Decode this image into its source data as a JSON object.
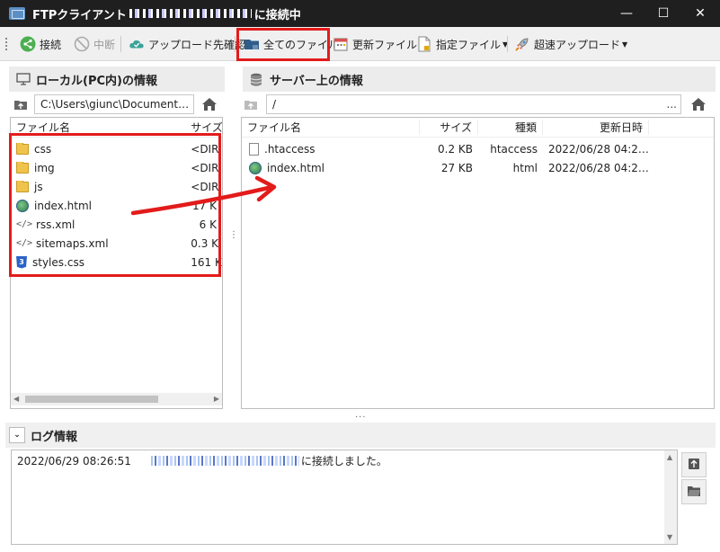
{
  "window": {
    "title_prefix": "FTPクライアント",
    "title_suffix": "に接続中",
    "minimize": "—",
    "maximize": "☐",
    "close": "✕"
  },
  "toolbar": {
    "connect": "接続",
    "abort": "中断",
    "upload_dest": "アップロード先確認",
    "all_files": "全てのファイル",
    "updated_files": "更新ファイル",
    "specified_files": "指定ファイル",
    "fast_upload": "超速アップロード"
  },
  "local": {
    "header": "ローカル(PC内)の情報",
    "path": "C:\\Users\\giunc\\Document…",
    "path_more": "...",
    "columns": [
      "ファイル名",
      "サイズ"
    ],
    "files": [
      {
        "name": "css",
        "size": "<DIR",
        "icon": "folder-icon"
      },
      {
        "name": "img",
        "size": "<DIR",
        "icon": "folder-icon"
      },
      {
        "name": "js",
        "size": "<DIR",
        "icon": "folder-icon"
      },
      {
        "name": "index.html",
        "size": "17 K",
        "icon": "html-icon"
      },
      {
        "name": "rss.xml",
        "size": "6 K",
        "icon": "xml-icon"
      },
      {
        "name": "sitemaps.xml",
        "size": "0.3 K",
        "icon": "xml-icon"
      },
      {
        "name": "styles.css",
        "size": "161 K",
        "icon": "css-icon"
      }
    ]
  },
  "server": {
    "header": "サーバー上の情報",
    "path": "/",
    "path_more": "...",
    "columns": [
      "ファイル名",
      "サイズ",
      "種類",
      "更新日時"
    ],
    "files": [
      {
        "name": ".htaccess",
        "size": "0.2 KB",
        "type": "htaccess",
        "date": "2022/06/28 04:2…",
        "icon": "doc-icon"
      },
      {
        "name": "index.html",
        "size": "27 KB",
        "type": "html",
        "date": "2022/06/28 04:2…",
        "icon": "html-icon"
      }
    ]
  },
  "log": {
    "header": "ログ情報",
    "entries": [
      {
        "time": "2022/06/29 08:26:51",
        "message": "に接続しました。"
      }
    ]
  },
  "colors": {
    "titlebar": "#1f1f1f",
    "highlight": "#e31b1b",
    "panel_bg": "#ececec"
  }
}
